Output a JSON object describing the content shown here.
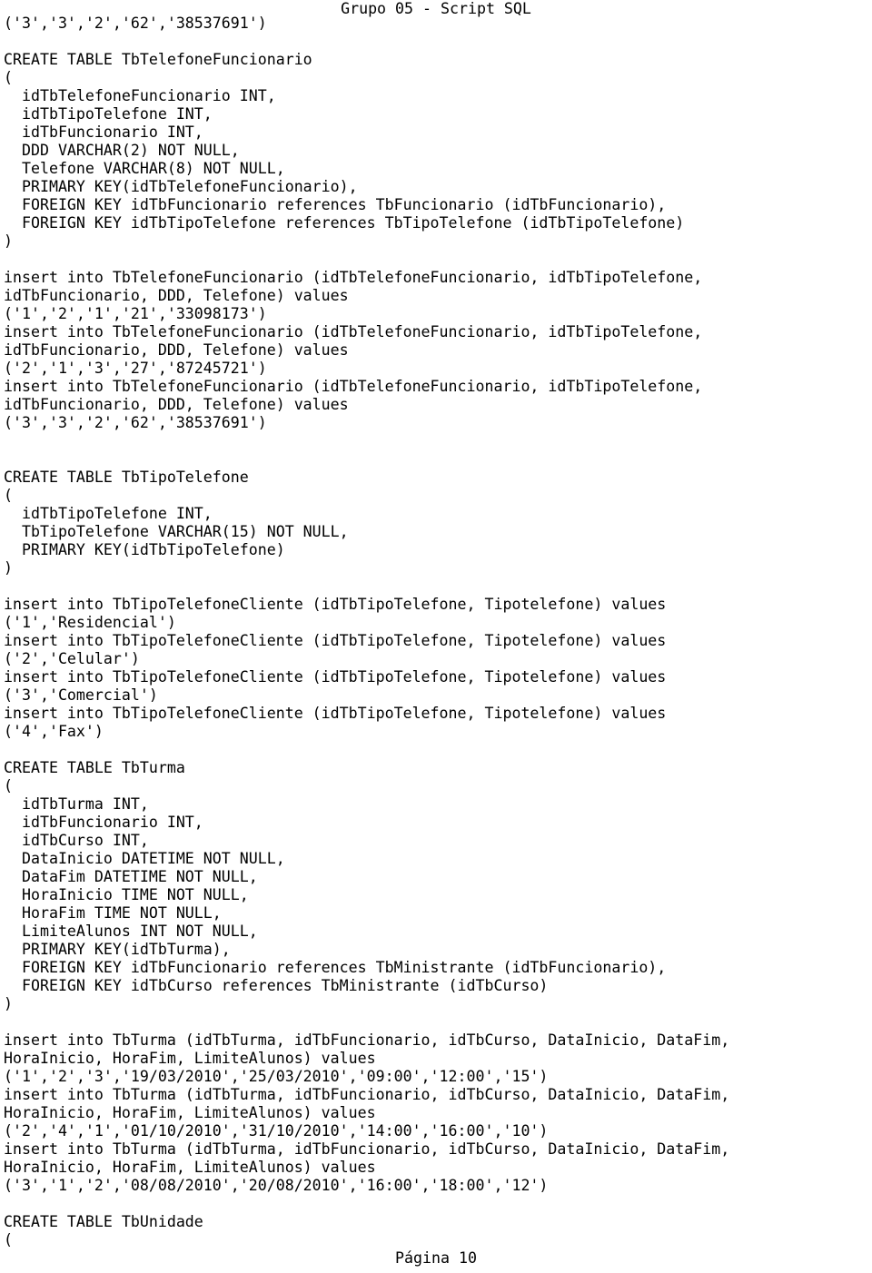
{
  "header": {
    "title": "Grupo 05 - Script SQL"
  },
  "footer": {
    "page_label": "Página 10"
  },
  "document": {
    "lines": [
      "('3','3','2','62','38537691')",
      "",
      "CREATE TABLE TbTelefoneFuncionario",
      "(",
      "  idTbTelefoneFuncionario INT,",
      "  idTbTipoTelefone INT,",
      "  idTbFuncionario INT,",
      "  DDD VARCHAR(2) NOT NULL,",
      "  Telefone VARCHAR(8) NOT NULL,",
      "  PRIMARY KEY(idTbTelefoneFuncionario),",
      "  FOREIGN KEY idTbFuncionario references TbFuncionario (idTbFuncionario),",
      "  FOREIGN KEY idTbTipoTelefone references TbTipoTelefone (idTbTipoTelefone)",
      ")",
      "",
      "insert into TbTelefoneFuncionario (idTbTelefoneFuncionario, idTbTipoTelefone,",
      "idTbFuncionario, DDD, Telefone) values",
      "('1','2','1','21','33098173')",
      "insert into TbTelefoneFuncionario (idTbTelefoneFuncionario, idTbTipoTelefone,",
      "idTbFuncionario, DDD, Telefone) values",
      "('2','1','3','27','87245721')",
      "insert into TbTelefoneFuncionario (idTbTelefoneFuncionario, idTbTipoTelefone,",
      "idTbFuncionario, DDD, Telefone) values",
      "('3','3','2','62','38537691')",
      "",
      "",
      "CREATE TABLE TbTipoTelefone",
      "(",
      "  idTbTipoTelefone INT,",
      "  TbTipoTelefone VARCHAR(15) NOT NULL,",
      "  PRIMARY KEY(idTbTipoTelefone)",
      ")",
      "",
      "insert into TbTipoTelefoneCliente (idTbTipoTelefone, Tipotelefone) values",
      "('1','Residencial')",
      "insert into TbTipoTelefoneCliente (idTbTipoTelefone, Tipotelefone) values",
      "('2','Celular')",
      "insert into TbTipoTelefoneCliente (idTbTipoTelefone, Tipotelefone) values",
      "('3','Comercial')",
      "insert into TbTipoTelefoneCliente (idTbTipoTelefone, Tipotelefone) values",
      "('4','Fax')",
      "",
      "CREATE TABLE TbTurma",
      "(",
      "  idTbTurma INT,",
      "  idTbFuncionario INT,",
      "  idTbCurso INT,",
      "  DataInicio DATETIME NOT NULL,",
      "  DataFim DATETIME NOT NULL,",
      "  HoraInicio TIME NOT NULL,",
      "  HoraFim TIME NOT NULL,",
      "  LimiteAlunos INT NOT NULL,",
      "  PRIMARY KEY(idTbTurma),",
      "  FOREIGN KEY idTbFuncionario references TbMinistrante (idTbFuncionario),",
      "  FOREIGN KEY idTbCurso references TbMinistrante (idTbCurso)",
      ")",
      "",
      "insert into TbTurma (idTbTurma, idTbFuncionario, idTbCurso, DataInicio, DataFim,",
      "HoraInicio, HoraFim, LimiteAlunos) values",
      "('1','2','3','19/03/2010','25/03/2010','09:00','12:00','15')",
      "insert into TbTurma (idTbTurma, idTbFuncionario, idTbCurso, DataInicio, DataFim,",
      "HoraInicio, HoraFim, LimiteAlunos) values",
      "('2','4','1','01/10/2010','31/10/2010','14:00','16:00','10')",
      "insert into TbTurma (idTbTurma, idTbFuncionario, idTbCurso, DataInicio, DataFim,",
      "HoraInicio, HoraFim, LimiteAlunos) values",
      "('3','1','2','08/08/2010','20/08/2010','16:00','18:00','12')",
      "",
      "CREATE TABLE TbUnidade",
      "("
    ]
  }
}
